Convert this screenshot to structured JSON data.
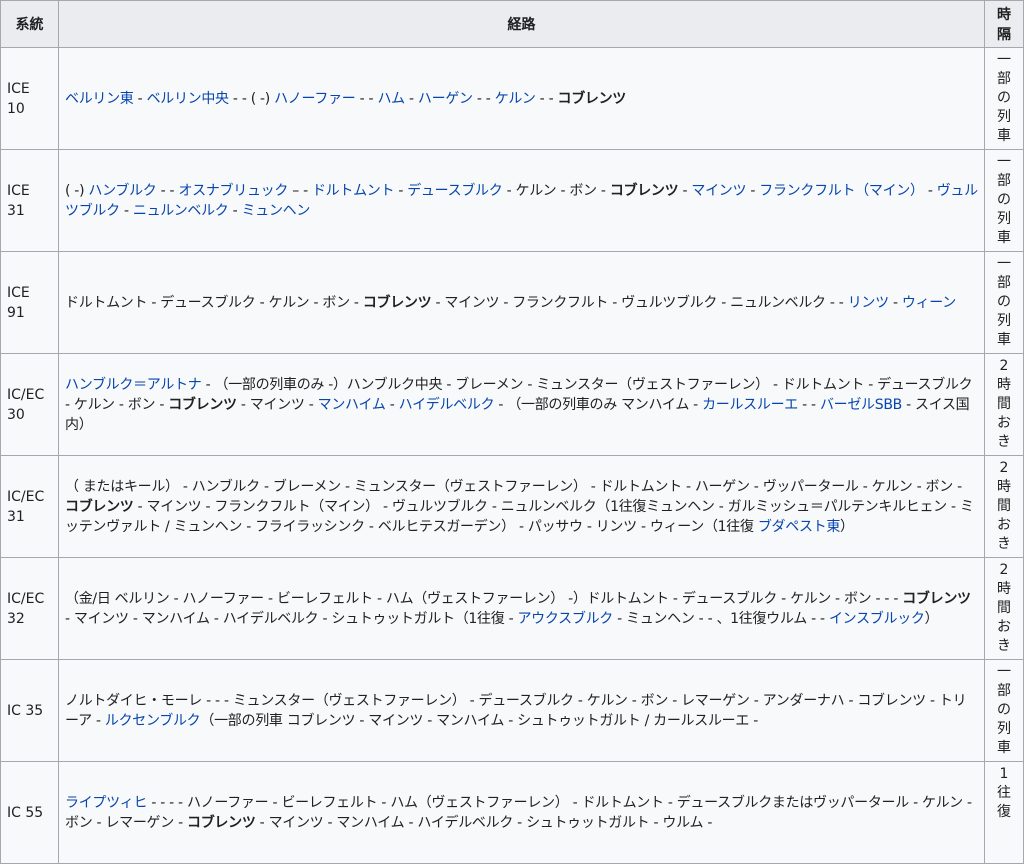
{
  "headers": {
    "system": "系統",
    "route": "経路",
    "interval_chars": [
      "時",
      "隔"
    ]
  },
  "rows": [
    {
      "system_lines": [
        "ICE",
        "10"
      ],
      "route": [
        {
          "text": "ベルリン東",
          "style": "link"
        },
        {
          "text": " - ",
          "style": "plain"
        },
        {
          "text": "ベルリン中央",
          "style": "link"
        },
        {
          "text": " - - ( -) ",
          "style": "plain"
        },
        {
          "text": "ハノーファー",
          "style": "link"
        },
        {
          "text": " - - ",
          "style": "plain"
        },
        {
          "text": "ハム",
          "style": "link"
        },
        {
          "text": " - ",
          "style": "plain"
        },
        {
          "text": "ハーゲン",
          "style": "link"
        },
        {
          "text": " - - ",
          "style": "plain"
        },
        {
          "text": "ケルン",
          "style": "link"
        },
        {
          "text": " - - ",
          "style": "plain"
        },
        {
          "text": "コブレンツ",
          "style": "bold"
        }
      ],
      "interval_chars": [
        "一",
        "部",
        "の",
        "列",
        "車"
      ]
    },
    {
      "system_lines": [
        "ICE",
        "31"
      ],
      "route": [
        {
          "text": "( -) ",
          "style": "plain"
        },
        {
          "text": "ハンブルク",
          "style": "link"
        },
        {
          "text": " - - ",
          "style": "plain"
        },
        {
          "text": "オスナブリュック",
          "style": "link"
        },
        {
          "text": " – - ",
          "style": "plain"
        },
        {
          "text": "ドルトムント",
          "style": "link"
        },
        {
          "text": " - ",
          "style": "plain"
        },
        {
          "text": "デュースブルク",
          "style": "link"
        },
        {
          "text": " - ケルン - ボン - ",
          "style": "plain"
        },
        {
          "text": "コブレンツ",
          "style": "bold"
        },
        {
          "text": " - ",
          "style": "plain"
        },
        {
          "text": "マインツ",
          "style": "link"
        },
        {
          "text": " - ",
          "style": "plain"
        },
        {
          "text": "フランクフルト（マイン）",
          "style": "link"
        },
        {
          "text": " - ",
          "style": "plain"
        },
        {
          "text": "ヴュルツブルク",
          "style": "link"
        },
        {
          "text": " - ",
          "style": "plain"
        },
        {
          "text": "ニュルンベルク",
          "style": "link"
        },
        {
          "text": " - ",
          "style": "plain"
        },
        {
          "text": "ミュンヘン",
          "style": "link"
        }
      ],
      "interval_chars": [
        "一",
        "部",
        "の",
        "列",
        "車"
      ]
    },
    {
      "system_lines": [
        "ICE",
        "91"
      ],
      "route": [
        {
          "text": "ドルトムント - デュースブルク - ケルン - ボン - ",
          "style": "plain"
        },
        {
          "text": "コブレンツ",
          "style": "bold"
        },
        {
          "text": " - マインツ - フランクフルト - ヴュルツブルク - ニュルンベルク - - ",
          "style": "plain"
        },
        {
          "text": "リンツ",
          "style": "link"
        },
        {
          "text": " - ",
          "style": "plain"
        },
        {
          "text": "ウィーン",
          "style": "link"
        }
      ],
      "interval_chars": [
        "一",
        "部",
        "の",
        "列",
        "車"
      ]
    },
    {
      "system_lines": [
        "IC/EC",
        "30"
      ],
      "route": [
        {
          "text": "ハンブルク＝アルトナ",
          "style": "link"
        },
        {
          "text": " - （一部の列車のみ -）ハンブルク中央 - ブレーメン - ミュンスター（ヴェストファーレン） - ドルトムント - デュースブルク - ケルン - ボン - ",
          "style": "plain"
        },
        {
          "text": "コブレンツ",
          "style": "bold"
        },
        {
          "text": " - マインツ - ",
          "style": "plain"
        },
        {
          "text": "マンハイム",
          "style": "link"
        },
        {
          "text": " - ",
          "style": "plain"
        },
        {
          "text": "ハイデルベルク",
          "style": "link"
        },
        {
          "text": " - （一部の列車のみ マンハイム - ",
          "style": "plain"
        },
        {
          "text": "カールスルーエ",
          "style": "link"
        },
        {
          "text": " - - ",
          "style": "plain"
        },
        {
          "text": "バーゼルSBB",
          "style": "link"
        },
        {
          "text": " - スイス国内）",
          "style": "plain"
        }
      ],
      "interval_chars": [
        "2",
        "時",
        "間",
        "お",
        "き"
      ]
    },
    {
      "system_lines": [
        "IC/EC",
        "31"
      ],
      "route": [
        {
          "text": "（ またはキール） - ハンブルク - ブレーメン - ミュンスター（ヴェストファーレン） - ドルトムント - ハーゲン - ヴッパータール - ケルン - ボン - ",
          "style": "plain"
        },
        {
          "text": "コブレンツ",
          "style": "bold"
        },
        {
          "text": " - マインツ - フランクフルト（マイン） - ヴュルツブルク - ニュルンベルク（1往復ミュンヘン - ガルミッシュ＝パルテンキルヒェン - ミッテンヴァルト / ミュンヘン - フライラッシンク - ベルヒテスガーデン） - パッサウ - リンツ - ウィーン（1往復 ",
          "style": "plain"
        },
        {
          "text": "ブダペスト東",
          "style": "link"
        },
        {
          "text": "）",
          "style": "plain"
        }
      ],
      "interval_chars": [
        "2",
        "時",
        "間",
        "お",
        "き"
      ]
    },
    {
      "system_lines": [
        "IC/EC",
        "32"
      ],
      "route": [
        {
          "text": "（金/日 ベルリン - ハノーファー - ビーレフェルト - ハム（ヴェストファーレン） -）ドルトムント - デュースブルク - ケルン - ボン - - - ",
          "style": "plain"
        },
        {
          "text": "コブレンツ",
          "style": "bold"
        },
        {
          "text": " - マインツ - マンハイム - ハイデルベルク - シュトゥットガルト（1往復 - ",
          "style": "plain"
        },
        {
          "text": "アウクスブルク",
          "style": "link"
        },
        {
          "text": " - ミュンヘン - - 、1往復ウルム - - ",
          "style": "plain"
        },
        {
          "text": "インスブルック",
          "style": "link"
        },
        {
          "text": "）",
          "style": "plain"
        }
      ],
      "interval_chars": [
        "2",
        "時",
        "間",
        "お",
        "き"
      ]
    },
    {
      "system_lines": [
        "IC 35"
      ],
      "route": [
        {
          "text": "ノルトダイヒ・モーレ - - - ミュンスター（ヴェストファーレン） - デュースブルク - ケルン - ボン - レマーゲン - アンダーナハ - コブレンツ - トリーア - ",
          "style": "plain"
        },
        {
          "text": "ルクセンブルク",
          "style": "link"
        },
        {
          "text": "（一部の列車 コブレンツ - マインツ - マンハイム - シュトゥットガルト / カールスルーエ -",
          "style": "plain"
        }
      ],
      "interval_chars": [
        "一",
        "部",
        "の",
        "列",
        "車"
      ]
    },
    {
      "system_lines": [
        "IC 55"
      ],
      "route": [
        {
          "text": "ライプツィヒ",
          "style": "link"
        },
        {
          "text": " - - - - ハノーファー - ビーレフェルト - ハム（ヴェストファーレン） - ドルトムント - デュースブルクまたはヴッパータール - ケルン - ボン - レマーゲン - ",
          "style": "plain"
        },
        {
          "text": "コブレンツ",
          "style": "bold"
        },
        {
          "text": " - マインツ - マンハイム - ハイデルベルク - シュトゥットガルト - ウルム -",
          "style": "plain"
        }
      ],
      "interval_chars": [
        "1",
        "往",
        "復"
      ]
    }
  ]
}
